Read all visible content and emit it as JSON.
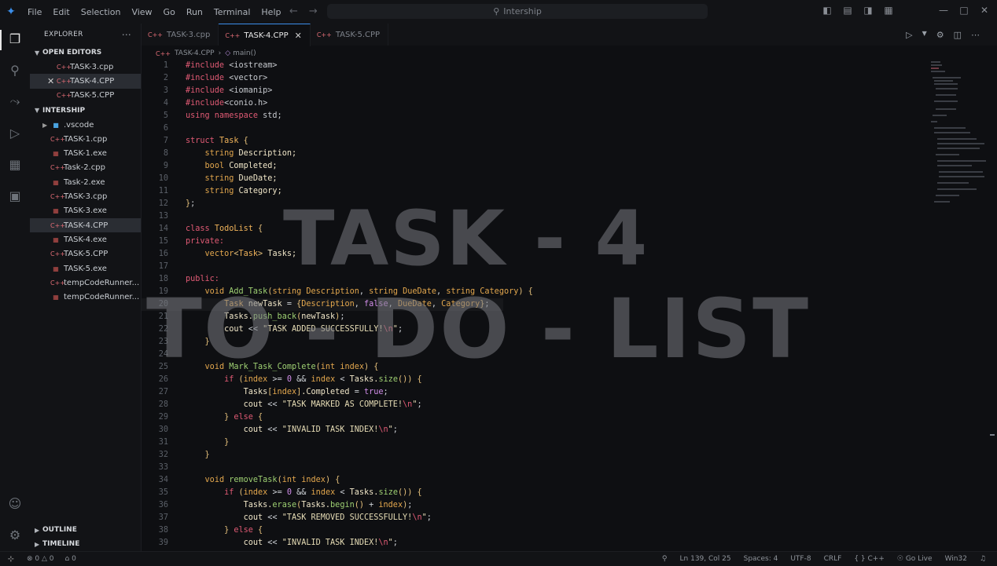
{
  "titlebar": {
    "menu": [
      "File",
      "Edit",
      "Selection",
      "View",
      "Go",
      "Run",
      "Terminal",
      "Help"
    ],
    "search_text": "Intership"
  },
  "sidebar": {
    "title": "EXPLORER",
    "open_editors_label": "OPEN EDITORS",
    "open_editors": [
      "TASK-3.cpp",
      "TASK-4.CPP",
      "TASK-5.CPP"
    ],
    "folder_label": "INTERSHIP",
    "files": [
      ".vscode",
      "TASK-1.cpp",
      "TASK-1.exe",
      "Task-2.cpp",
      "Task-2.exe",
      "TASK-3.cpp",
      "TASK-3.exe",
      "TASK-4.CPP",
      "TASK-4.exe",
      "TASK-5.CPP",
      "TASK-5.exe",
      "tempCodeRunner...",
      "tempCodeRunner..."
    ],
    "outline_label": "OUTLINE",
    "timeline_label": "TIMELINE"
  },
  "tabs": [
    "TASK-3.cpp",
    "TASK-4.CPP",
    "TASK-5.CPP"
  ],
  "breadcrumb": {
    "file": "TASK-4.CPP",
    "symbol": "main()"
  },
  "overlay": {
    "line1": "TASK - 4",
    "line2": "TO - DO - LIST"
  },
  "status": {
    "errors": "0",
    "warnings": "0",
    "ports": "0",
    "position": "Ln 139, Col 25",
    "spaces": "Spaces: 4",
    "encoding": "UTF-8",
    "eol": "CRLF",
    "language": "C++",
    "golive": "Go Live",
    "platform": "Win32"
  },
  "colors": {
    "accent": "#3b8eea",
    "keyword": "#e05a74",
    "function": "#9ed072",
    "type": "#e3a74d"
  }
}
